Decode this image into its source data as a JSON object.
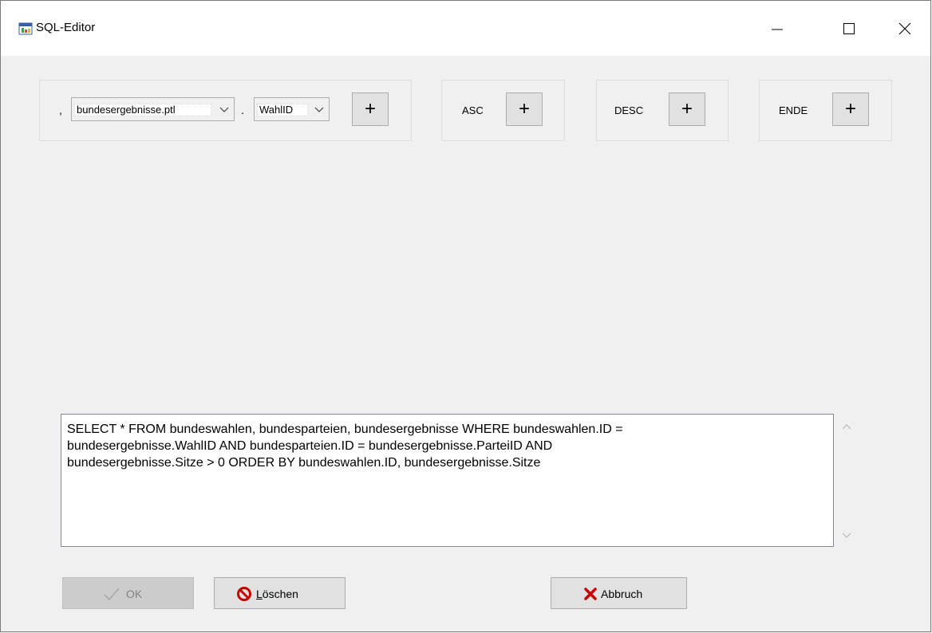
{
  "window": {
    "title": "SQL-Editor"
  },
  "builder": {
    "comma": ",",
    "table_select_value": "bundesergebnisse.ptl",
    "dot": ".",
    "field_select_value": "WahlID",
    "plus": "+",
    "asc_label": "ASC",
    "desc_label": "DESC",
    "ende_label": "ENDE"
  },
  "sql": {
    "line1": "SELECT * FROM bundeswahlen, bundesparteien, bundesergebnisse WHERE bundeswahlen.ID =",
    "line2": "bundesergebnisse.WahlID AND bundesparteien.ID = bundesergebnisse.ParteiID AND",
    "line3": "bundesergebnisse.Sitze > 0 ORDER BY bundeswahlen.ID, bundesergebnisse.Sitze"
  },
  "buttons": {
    "ok_label": "OK",
    "loeschen_first": "L",
    "loeschen_rest": "öschen",
    "abbruch_label": "Abbruch"
  },
  "colors": {
    "delete_icon": "#c80000",
    "cancel_icon": "#cc0000"
  }
}
